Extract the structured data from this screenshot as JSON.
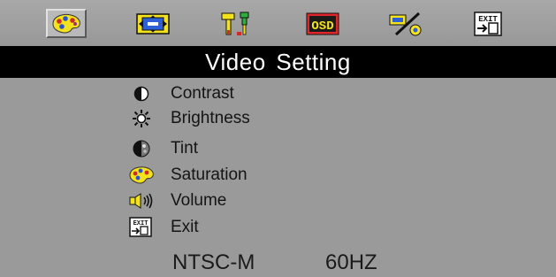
{
  "tabs": [
    {
      "id": "video",
      "icon": "palette-icon",
      "active": true
    },
    {
      "id": "display",
      "icon": "screen-adjust-icon",
      "active": false
    },
    {
      "id": "settings",
      "icon": "tools-icon",
      "active": false
    },
    {
      "id": "osd",
      "icon": "osd-icon",
      "label": "OSD",
      "active": false
    },
    {
      "id": "function",
      "icon": "percent-icon",
      "active": false
    },
    {
      "id": "exit",
      "icon": "exit-icon",
      "label": "EXIT",
      "active": false
    }
  ],
  "title": "Video Setting",
  "menu": [
    {
      "icon": "contrast-icon",
      "label": "Contrast"
    },
    {
      "icon": "brightness-icon",
      "label": "Brightness"
    },
    {
      "icon": "tint-icon",
      "label": "Tint"
    },
    {
      "icon": "palette-icon",
      "label": "Saturation"
    },
    {
      "icon": "volume-icon",
      "label": "Volume"
    },
    {
      "icon": "exit-icon",
      "label": "Exit"
    }
  ],
  "status": {
    "system": "NTSC-M",
    "frequency": "60HZ"
  },
  "colors": {
    "background": "#9a9a9a",
    "title_bar": "#000000",
    "title_text": "#ffffff"
  }
}
